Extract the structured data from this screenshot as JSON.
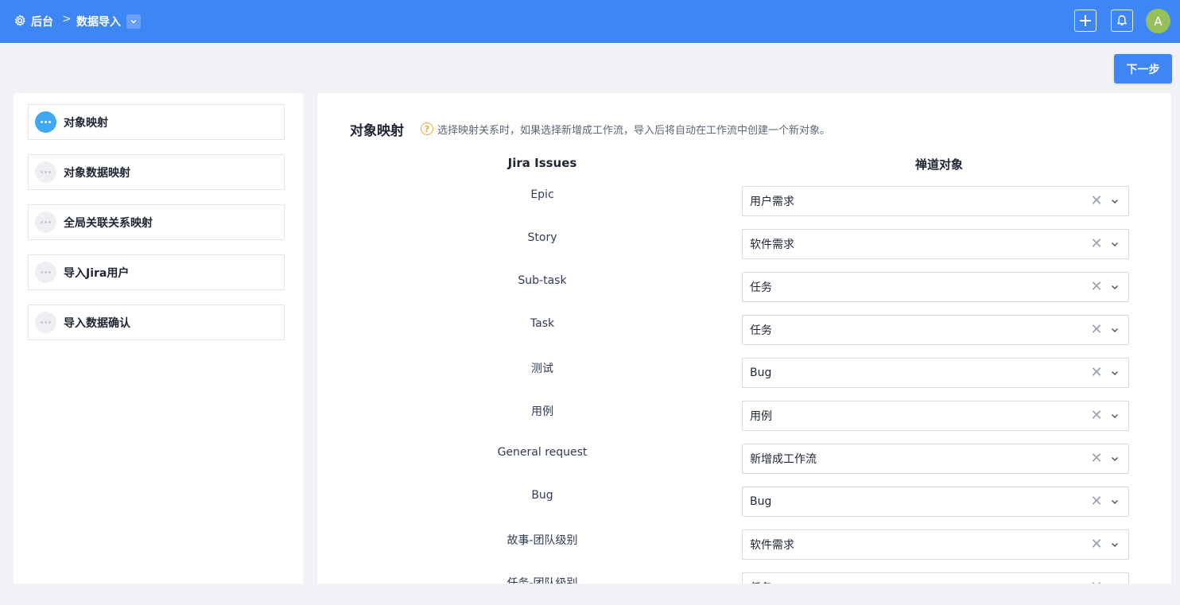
{
  "header": {
    "home": "后台",
    "separator": ">",
    "current": "数据导入",
    "avatar_letter": "A"
  },
  "actions": {
    "next_label": "下一步"
  },
  "steps": [
    {
      "label": "对象映射",
      "active": true
    },
    {
      "label": "对象数据映射",
      "active": false
    },
    {
      "label": "全局关联关系映射",
      "active": false
    },
    {
      "label": "导入Jira用户",
      "active": false
    },
    {
      "label": "导入数据确认",
      "active": false
    }
  ],
  "main": {
    "title": "对象映射",
    "hint_icon": "?",
    "hint": "选择映射关系时，如果选择新增成工作流，导入后将自动在工作流中创建一个新对象。",
    "col_left": "Jira Issues",
    "col_right": "禅道对象",
    "clear_glyph": "✕",
    "rows": [
      {
        "source": "Epic",
        "target": "用户需求"
      },
      {
        "source": "Story",
        "target": "软件需求"
      },
      {
        "source": "Sub-task",
        "target": "任务"
      },
      {
        "source": "Task",
        "target": "任务"
      },
      {
        "source": "测试",
        "target": "Bug"
      },
      {
        "source": "用例",
        "target": "用例"
      },
      {
        "source": "General request",
        "target": "新增成工作流"
      },
      {
        "source": "Bug",
        "target": "Bug"
      },
      {
        "source": "故事-团队级别",
        "target": "软件需求"
      },
      {
        "source": "任务-团队级别",
        "target": "任务"
      }
    ]
  },
  "colors": {
    "primary": "#3e86f5",
    "active_step": "#3ea8f5",
    "hint": "#f0a23a",
    "avatar": "#95c05c"
  }
}
